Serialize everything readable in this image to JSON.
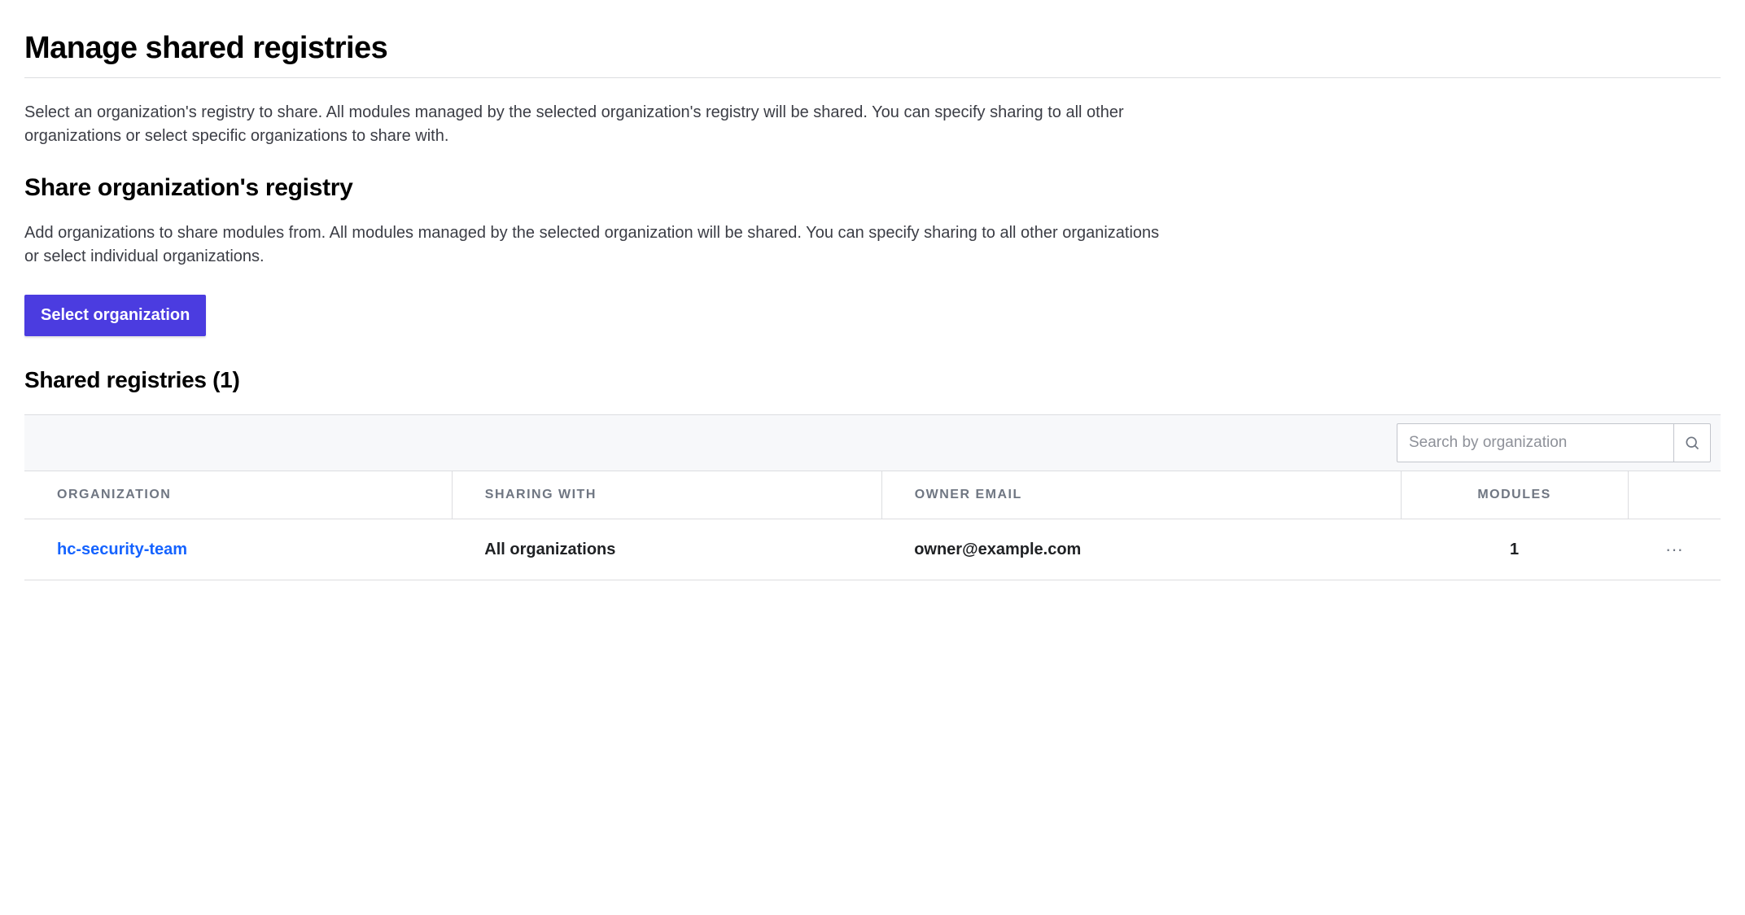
{
  "page": {
    "title": "Manage shared registries",
    "intro": "Select an organization's registry to share. All modules managed by the selected organization's registry will be shared. You can specify sharing to all other organizations or select specific organizations to share with."
  },
  "share_section": {
    "title": "Share organization's registry",
    "description": "Add organizations to share modules from. All modules managed by the selected organization will be shared. You can specify sharing to all other organizations or select individual organizations.",
    "button_label": "Select organization"
  },
  "list_section": {
    "title": "Shared registries (1)",
    "search_placeholder": "Search by organization",
    "columns": {
      "organization": "ORGANIZATION",
      "sharing_with": "SHARING WITH",
      "owner_email": "OWNER EMAIL",
      "modules": "MODULES"
    },
    "rows": [
      {
        "organization": "hc-security-team",
        "sharing_with": "All organizations",
        "owner_email": "owner@example.com",
        "modules": "1"
      }
    ]
  }
}
